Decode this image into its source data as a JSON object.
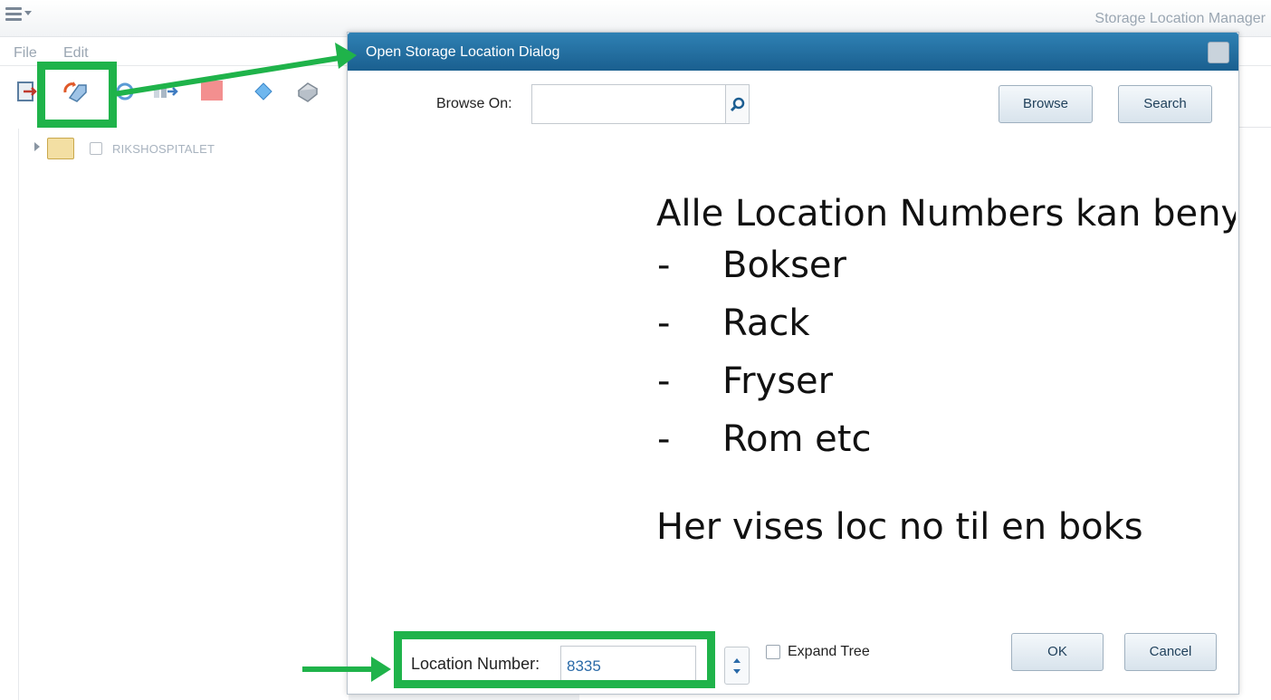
{
  "app": {
    "title": "Storage Location Manager",
    "menu": [
      "File",
      "Edit"
    ]
  },
  "toolbar": {
    "tools": [
      "export-icon",
      "refresh-tag-icon",
      "sync-icon",
      "transfer-icon",
      "stop-icon",
      "diamond-icon",
      "printer-icon"
    ]
  },
  "tree": {
    "root_label": "RIKSHOSPITALET"
  },
  "dialog": {
    "title": "Open Storage Location Dialog",
    "browse_on_label": "Browse On:",
    "browse_on_value": "",
    "browse_button": "Browse",
    "search_button": "Search",
    "location_number_label": "Location Number:",
    "location_number_value": "8335",
    "expand_tree_label": "Expand Tree",
    "expand_tree_checked": false,
    "ok_button": "OK",
    "cancel_button": "Cancel"
  },
  "annotation": {
    "heading": "Alle Location Numbers kan benyttes",
    "bullets": [
      "Bokser",
      "Rack",
      "Fryser",
      "Rom etc"
    ],
    "footer": "Her vises loc no til en boks",
    "highlight_color": "#1fb34a"
  }
}
